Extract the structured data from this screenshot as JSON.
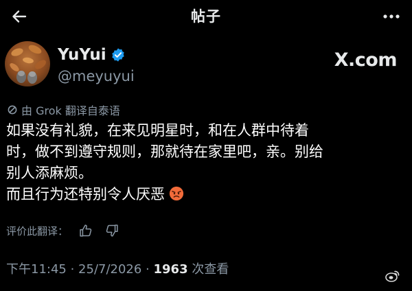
{
  "header": {
    "title": "帖子",
    "back_icon": "arrow-left-icon",
    "more_icon": "more-horizontal-icon"
  },
  "author": {
    "display_name": "YuYui",
    "handle": "@meyuyui",
    "verified_icon": "verified-badge-icon",
    "verified_color": "#1d9bf0"
  },
  "watermark": {
    "x": "X",
    "rest": ".com"
  },
  "translation": {
    "prefix": "由 Grok 翻译自泰语",
    "icon": "no-translate-icon"
  },
  "post": {
    "lines": [
      "如果没有礼貌，在来见明星时，和在人群中待着",
      "时，做不到遵守规则，那就待在家里吧，亲。别给",
      "别人添麻烦。",
      "而且行为还特别令人厌恶"
    ],
    "emoji": "angry-face-emoji"
  },
  "rate_translation": {
    "label": "评价此翻译：",
    "thumbs_up_icon": "thumbs-up-icon",
    "thumbs_down_icon": "thumbs-down-icon"
  },
  "meta": {
    "time": "下午11:45 · 25/7/2026 · ",
    "views_count": "1963",
    "views_label": " 次查看"
  },
  "source_mark": {
    "icon": "weibo-icon",
    "text": ""
  }
}
